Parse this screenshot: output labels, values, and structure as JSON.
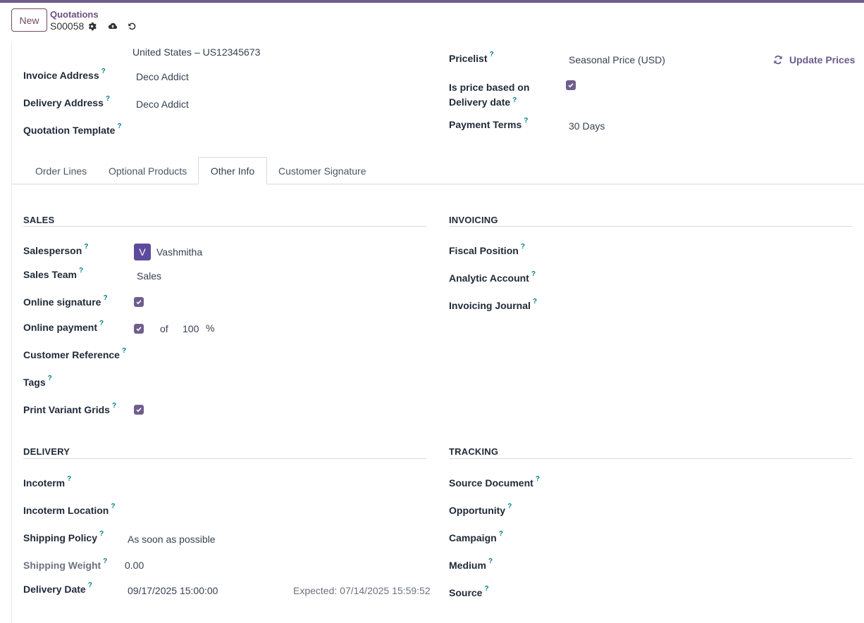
{
  "control_panel": {
    "new_label": "New",
    "breadcrumb_parent": "Quotations",
    "record_name": "S00058"
  },
  "header_fields": {
    "address_line": "United States – US12345673",
    "invoice_address": {
      "label": "Invoice Address",
      "value": "Deco Addict"
    },
    "delivery_address": {
      "label": "Delivery Address",
      "value": "Deco Addict"
    },
    "quotation_template": {
      "label": "Quotation Template",
      "value": ""
    },
    "pricelist": {
      "label": "Pricelist",
      "value": "Seasonal Price (USD)"
    },
    "update_prices": "Update Prices",
    "price_delivery": {
      "label_line1": "Is price based on",
      "label_line2": "Delivery date",
      "checked": true
    },
    "payment_terms": {
      "label": "Payment Terms",
      "value": "30 Days"
    }
  },
  "tabs": [
    {
      "label": "Order Lines",
      "active": false
    },
    {
      "label": "Optional Products",
      "active": false
    },
    {
      "label": "Other Info",
      "active": true
    },
    {
      "label": "Customer Signature",
      "active": false
    }
  ],
  "sales": {
    "title": "SALES",
    "salesperson": {
      "label": "Salesperson",
      "avatar": "V",
      "value": "Vashmitha"
    },
    "sales_team": {
      "label": "Sales Team",
      "value": "Sales"
    },
    "online_signature": {
      "label": "Online signature",
      "checked": true
    },
    "online_payment": {
      "label": "Online payment",
      "checked": true,
      "of": "of",
      "percent": "100",
      "unit": "%"
    },
    "customer_reference": {
      "label": "Customer Reference",
      "value": ""
    },
    "tags": {
      "label": "Tags",
      "value": ""
    },
    "print_variant_grids": {
      "label": "Print Variant Grids",
      "checked": true
    }
  },
  "invoicing": {
    "title": "INVOICING",
    "fiscal_position": {
      "label": "Fiscal Position"
    },
    "analytic_account": {
      "label": "Analytic Account"
    },
    "invoicing_journal": {
      "label": "Invoicing Journal"
    }
  },
  "delivery": {
    "title": "DELIVERY",
    "incoterm": {
      "label": "Incoterm"
    },
    "incoterm_location": {
      "label": "Incoterm Location"
    },
    "shipping_policy": {
      "label": "Shipping Policy",
      "value": "As soon as possible"
    },
    "shipping_weight": {
      "label": "Shipping Weight",
      "value": "0.00"
    },
    "delivery_date": {
      "label": "Delivery Date",
      "value": "09/17/2025 15:00:00",
      "expected": "Expected: 07/14/2025 15:59:52"
    }
  },
  "tracking": {
    "title": "TRACKING",
    "source_document": {
      "label": "Source Document"
    },
    "opportunity": {
      "label": "Opportunity"
    },
    "campaign": {
      "label": "Campaign"
    },
    "medium": {
      "label": "Medium"
    },
    "source": {
      "label": "Source"
    }
  },
  "help_mark": "?",
  "colors": {
    "brand": "#714b67",
    "accent": "#6f5e8c",
    "help": "#017e84"
  }
}
